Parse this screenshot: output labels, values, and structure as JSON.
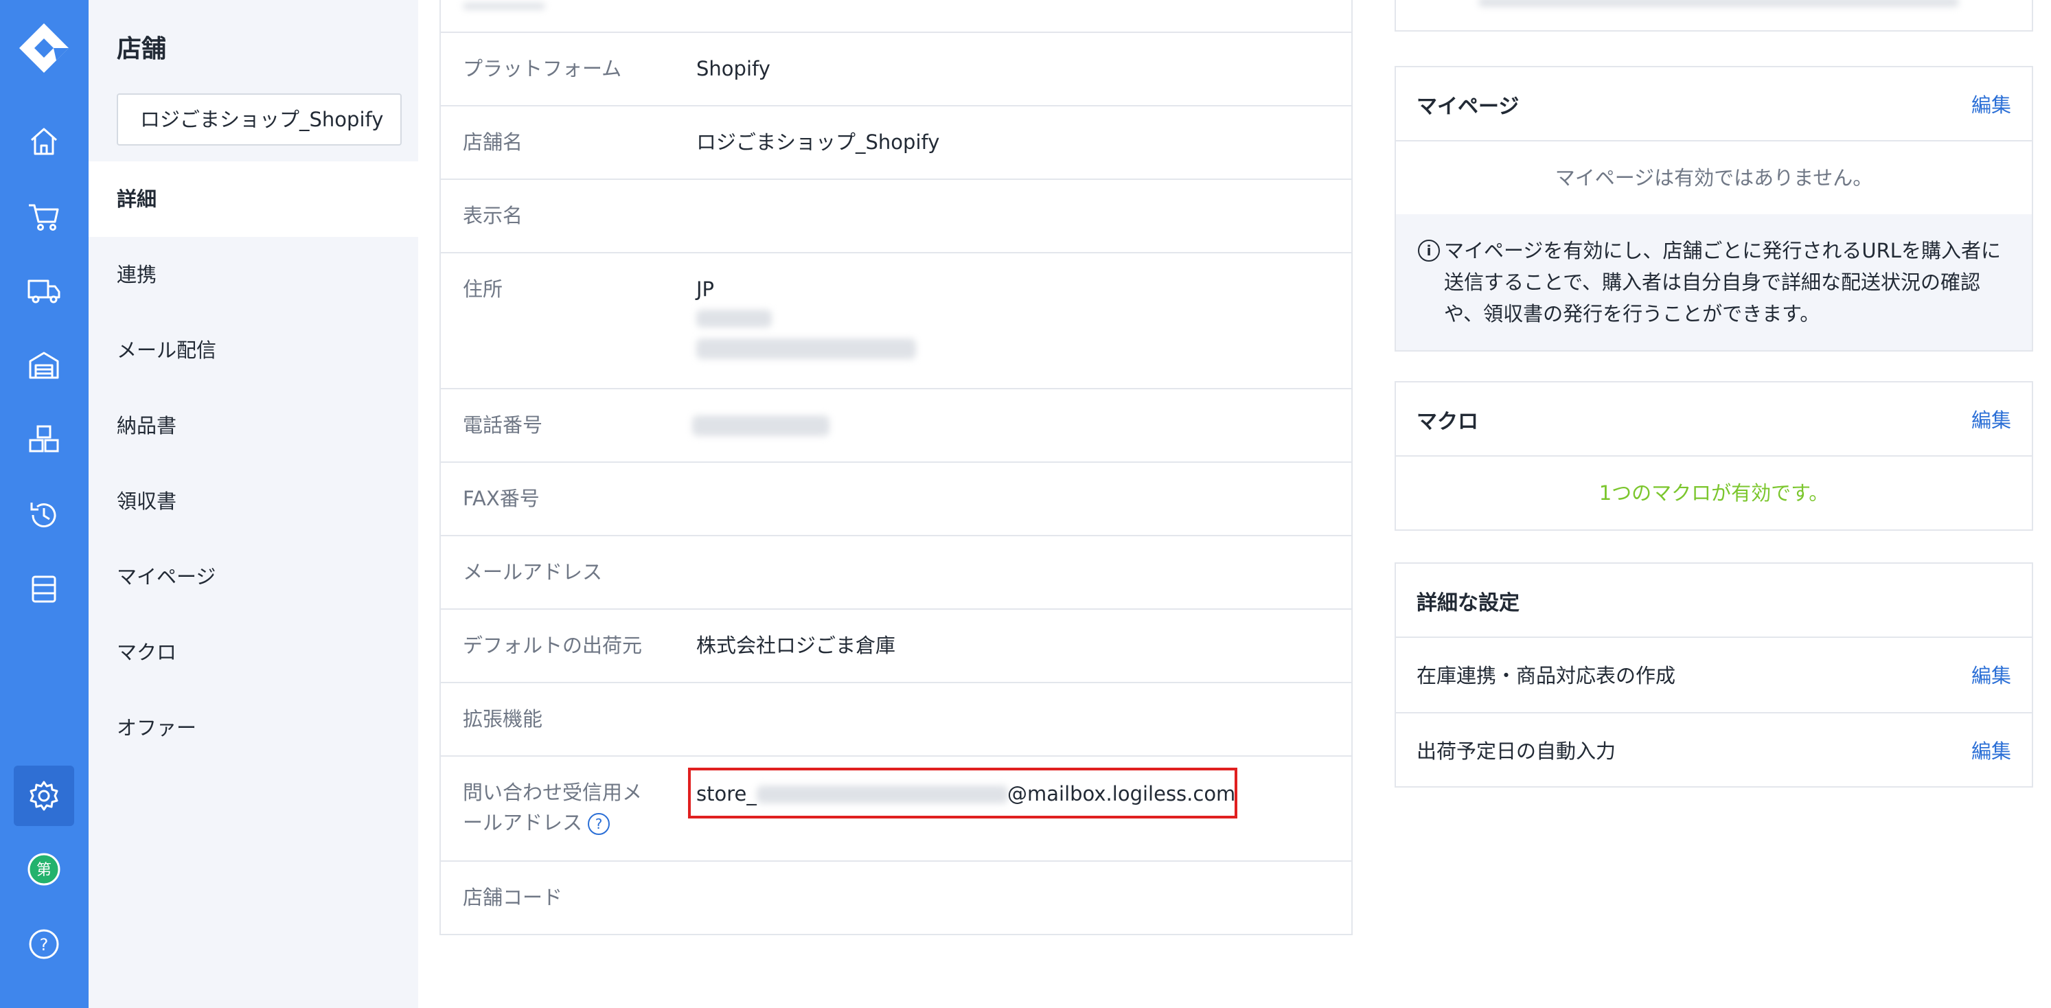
{
  "sidebar": {
    "icons": [
      "logo-icon",
      "home-icon",
      "cart-icon",
      "truck-icon",
      "warehouse-icon",
      "boxes-icon",
      "history-icon",
      "list-icon",
      "gear-icon",
      "user-avatar-icon",
      "help-icon"
    ],
    "avatar_label": "第",
    "help_label": "?"
  },
  "subnav": {
    "title": "店舗",
    "store_select": "ロジごまショップ_Shopify",
    "items": [
      {
        "label": "詳細"
      },
      {
        "label": "連携"
      },
      {
        "label": "メール配信"
      },
      {
        "label": "納品書"
      },
      {
        "label": "領収書"
      },
      {
        "label": "マイページ"
      },
      {
        "label": "マクロ"
      },
      {
        "label": "オファー"
      }
    ]
  },
  "details": {
    "platform_label": "プラットフォーム",
    "platform_value": "Shopify",
    "store_name_label": "店舗名",
    "store_name_value": "ロジごまショップ_Shopify",
    "display_name_label": "表示名",
    "address_label": "住所",
    "address_country": "JP",
    "phone_label": "電話番号",
    "fax_label": "FAX番号",
    "email_label": "メールアドレス",
    "default_ship_label": "デフォルトの出荷元",
    "default_ship_value": "株式会社ロジごま倉庫",
    "extension_label": "拡張機能",
    "inquiry_label_1": "問い合わせ受信用メ",
    "inquiry_label_2": "ールアドレス",
    "inquiry_help": "?",
    "inquiry_prefix": "store_",
    "inquiry_suffix": "@mailbox.logiless.com",
    "store_code_label": "店舗コード"
  },
  "mypage_card": {
    "title": "マイページ",
    "edit": "編集",
    "status": "マイページは有効ではありません。",
    "info_icon": "i",
    "info": "マイページを有効にし、店舗ごとに発行されるURLを購入者に送信することで、購入者は自分自身で詳細な配送状況の確認や、領収書の発行を行うことができます。"
  },
  "macro_card": {
    "title": "マクロ",
    "edit": "編集",
    "status": "1つのマクロが有効です。"
  },
  "advanced_card": {
    "title": "詳細な設定",
    "rows": [
      {
        "label": "在庫連携・商品対応表の作成",
        "edit": "編集"
      },
      {
        "label": "出荷予定日の自動入力",
        "edit": "編集"
      }
    ]
  },
  "colors": {
    "rail": "#3f86ec",
    "accent": "#2b6fd6",
    "success": "#7bc62d",
    "highlight": "#e02020"
  }
}
